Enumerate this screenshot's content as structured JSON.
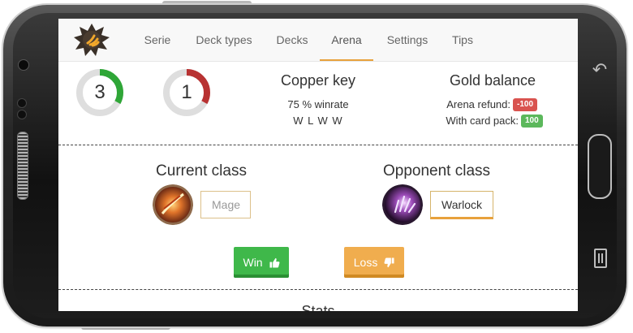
{
  "nav": {
    "logo_icon": "hearthstone-claw-logo-icon",
    "items": [
      "Serie",
      "Deck types",
      "Decks",
      "Arena",
      "Settings",
      "Tips"
    ],
    "active": "Arena",
    "accent": "#e8a13c"
  },
  "arena_stats": {
    "wins": {
      "value": "3",
      "progress_fraction": 0.33,
      "color": "#2fa637"
    },
    "losses": {
      "value": "1",
      "progress_fraction": 0.33,
      "color": "#b83232"
    }
  },
  "key": {
    "title": "Copper key",
    "winrate": "75 % winrate",
    "results": "W L W W"
  },
  "gold": {
    "title": "Gold balance",
    "refund_label": "Arena refund:",
    "refund_value": "-100",
    "refund_color": "#d9534f",
    "pack_label": "With card pack:",
    "pack_value": "100",
    "pack_color": "#5cb85c"
  },
  "current_class": {
    "title": "Current class",
    "icon": "mage-fire-icon",
    "placeholder": "Mage"
  },
  "opponent_class": {
    "title": "Opponent class",
    "icon": "warlock-hand-icon",
    "value": "Warlock"
  },
  "buttons": {
    "win_label": "Win",
    "win_icon": "thumbs-up-icon",
    "loss_label": "Loss",
    "loss_icon": "thumbs-down-icon"
  },
  "bottom_section": {
    "title": "Stats"
  }
}
